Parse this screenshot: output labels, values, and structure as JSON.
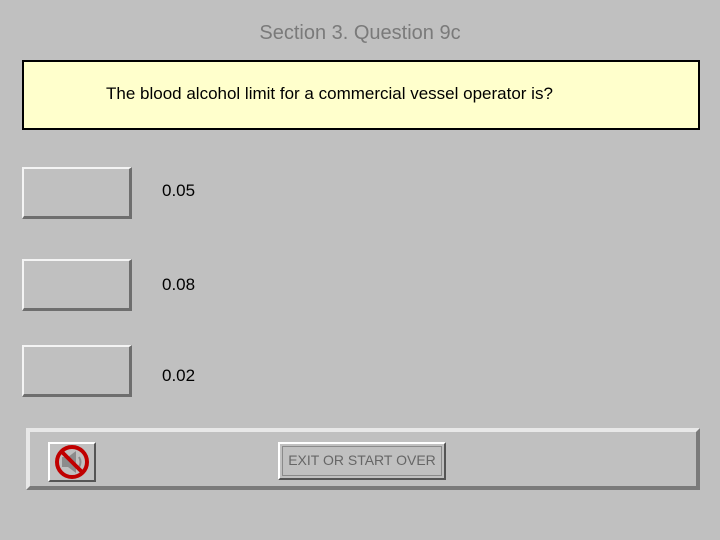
{
  "header": {
    "title": "Section 3. Question 9c"
  },
  "question": {
    "text": "The blood alcohol limit for a commercial vessel operator is?"
  },
  "answers": [
    {
      "label": "0.05"
    },
    {
      "label": "0.08"
    },
    {
      "label": "0.02"
    }
  ],
  "footer": {
    "mute_icon": "speaker-muted-icon",
    "exit_label": "EXIT OR START OVER"
  },
  "colors": {
    "background": "#c0c0c0",
    "question_box": "#ffffcc",
    "mute_slash": "#c00000"
  }
}
